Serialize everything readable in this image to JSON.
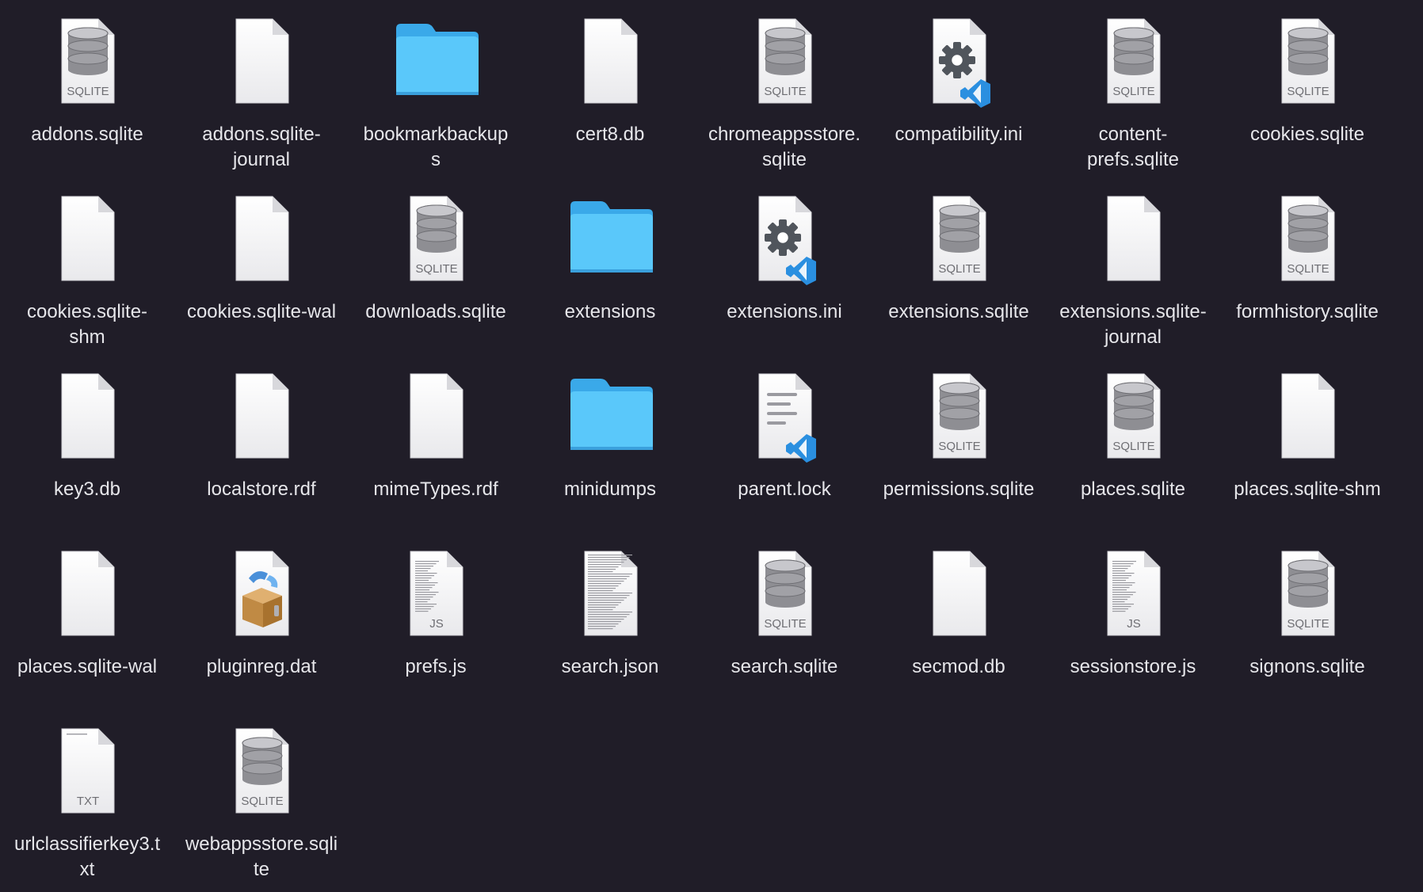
{
  "window": {
    "view": "icon-grid"
  },
  "files": [
    {
      "name": "addons.sqlite",
      "icon": "sqlite-database-icon",
      "badge": "SQLITE"
    },
    {
      "name": "addons.sqlite-\njournal",
      "icon": "blank-document-icon"
    },
    {
      "name": "bookmarkbackup\ns",
      "icon": "folder-icon"
    },
    {
      "name": "cert8.db",
      "icon": "blank-document-icon"
    },
    {
      "name": "chromeappsstore.\nsqlite",
      "icon": "sqlite-database-icon",
      "badge": "SQLITE"
    },
    {
      "name": "compatibility.ini",
      "icon": "vscode-settings-document-icon"
    },
    {
      "name": "content-\nprefs.sqlite",
      "icon": "sqlite-database-icon",
      "badge": "SQLITE"
    },
    {
      "name": "cookies.sqlite",
      "icon": "sqlite-database-icon",
      "badge": "SQLITE"
    },
    {
      "name": "cookies.sqlite-\nshm",
      "icon": "blank-document-icon"
    },
    {
      "name": "cookies.sqlite-wal",
      "icon": "blank-document-icon"
    },
    {
      "name": "downloads.sqlite",
      "icon": "sqlite-database-icon",
      "badge": "SQLITE"
    },
    {
      "name": "extensions",
      "icon": "folder-icon"
    },
    {
      "name": "extensions.ini",
      "icon": "vscode-settings-document-icon"
    },
    {
      "name": "extensions.sqlite",
      "icon": "sqlite-database-icon",
      "badge": "SQLITE"
    },
    {
      "name": "extensions.sqlite-\njournal",
      "icon": "blank-document-icon"
    },
    {
      "name": "formhistory.sqlite",
      "icon": "sqlite-database-icon",
      "badge": "SQLITE"
    },
    {
      "name": "key3.db",
      "icon": "blank-document-icon"
    },
    {
      "name": "localstore.rdf",
      "icon": "blank-document-icon"
    },
    {
      "name": "mimeTypes.rdf",
      "icon": "blank-document-icon"
    },
    {
      "name": "minidumps",
      "icon": "folder-icon"
    },
    {
      "name": "parent.lock",
      "icon": "vscode-text-document-icon"
    },
    {
      "name": "permissions.sqlite",
      "icon": "sqlite-database-icon",
      "badge": "SQLITE"
    },
    {
      "name": "places.sqlite",
      "icon": "sqlite-database-icon",
      "badge": "SQLITE"
    },
    {
      "name": "places.sqlite-shm",
      "icon": "blank-document-icon"
    },
    {
      "name": "places.sqlite-wal",
      "icon": "blank-document-icon"
    },
    {
      "name": "pluginreg.dat",
      "icon": "installer-package-icon"
    },
    {
      "name": "prefs.js",
      "icon": "js-document-icon",
      "badge": "JS"
    },
    {
      "name": "search.json",
      "icon": "text-preview-document-icon"
    },
    {
      "name": "search.sqlite",
      "icon": "sqlite-database-icon",
      "badge": "SQLITE"
    },
    {
      "name": "secmod.db",
      "icon": "blank-document-icon"
    },
    {
      "name": "sessionstore.js",
      "icon": "js-document-icon",
      "badge": "JS"
    },
    {
      "name": "signons.sqlite",
      "icon": "sqlite-database-icon",
      "badge": "SQLITE"
    },
    {
      "name": "urlclassifierkey3.t\nxt",
      "icon": "txt-document-icon",
      "badge": "TXT"
    },
    {
      "name": "webappsstore.sqli\nte",
      "icon": "sqlite-database-icon",
      "badge": "SQLITE"
    }
  ],
  "colors": {
    "background": "#201d28",
    "label": "#e6e6ea",
    "folder": "#5ac8fa",
    "vscode_blue": "#2a8fe0"
  }
}
